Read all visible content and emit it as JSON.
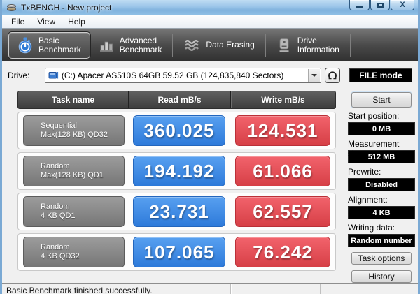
{
  "titlebar": {
    "title": "TxBENCH - New project",
    "close_glyph": "X"
  },
  "menubar": {
    "items": [
      "File",
      "View",
      "Help"
    ]
  },
  "toolbar": {
    "tabs": [
      {
        "id": "basic-benchmark",
        "lines": [
          "Basic",
          "Benchmark"
        ],
        "active": true
      },
      {
        "id": "advanced-benchmark",
        "lines": [
          "Advanced",
          "Benchmark"
        ],
        "active": false
      },
      {
        "id": "data-erasing",
        "lines": [
          "Data Erasing"
        ],
        "active": false
      },
      {
        "id": "drive-information",
        "lines": [
          "Drive",
          "Information"
        ],
        "active": false
      }
    ]
  },
  "drive_bar": {
    "label": "Drive:",
    "selected_drive": "(C:) Apacer AS510S 64GB  59.52 GB (124,835,840 Sectors)",
    "file_mode_button": "FILE mode"
  },
  "benchmark_table": {
    "headers": {
      "task": "Task name",
      "read": "Read mB/s",
      "write": "Write mB/s"
    },
    "rows": [
      {
        "task_lines": [
          "Sequential",
          "Max(128 KB) QD32"
        ],
        "read": "360.025",
        "write": "124.531"
      },
      {
        "task_lines": [
          "Random",
          "Max(128 KB) QD1"
        ],
        "read": "194.192",
        "write": "61.066"
      },
      {
        "task_lines": [
          "Random",
          "4 KB QD1"
        ],
        "read": "23.731",
        "write": "62.557"
      },
      {
        "task_lines": [
          "Random",
          "4 KB QD32"
        ],
        "read": "107.065",
        "write": "76.242"
      }
    ]
  },
  "side_panel": {
    "start_button": "Start",
    "fields": [
      {
        "label": "Start position:",
        "value": "0 MB"
      },
      {
        "label": "Measurement size:",
        "value": "512 MB"
      },
      {
        "label": "Prewrite:",
        "value": "Disabled"
      },
      {
        "label": "Alignment:",
        "value": "4 KB"
      },
      {
        "label": "Writing data:",
        "value": "Random number"
      }
    ],
    "task_options_button": "Task options",
    "history_button": "History"
  },
  "statusbar": {
    "message": "Basic Benchmark finished successfully."
  },
  "colors": {
    "read_value_blue": "#3b85e0",
    "write_value_red": "#e0464d",
    "task_chip_gray": "#8a8a8a",
    "table_header_gray": "#4c4c4c",
    "file_mode_bg": "#000000",
    "titlebar_blue": "#8ebfe5",
    "toolbar_dark": "#4a4a4a"
  }
}
